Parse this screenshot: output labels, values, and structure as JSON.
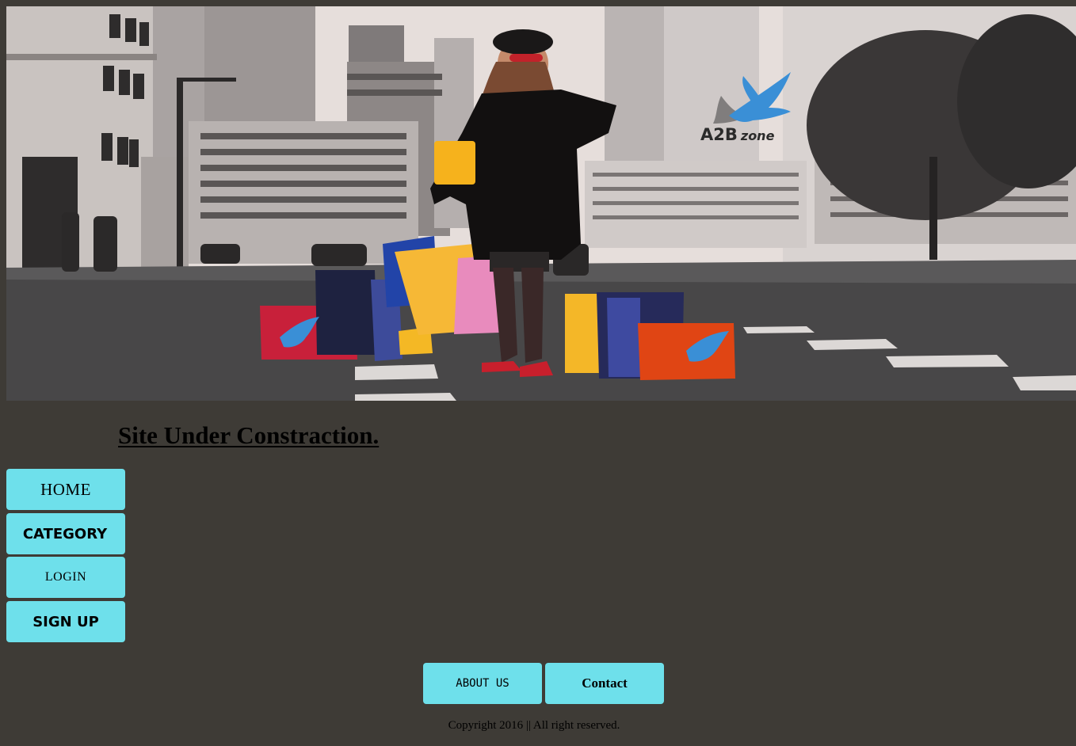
{
  "hero": {
    "brand_main": "A2B",
    "brand_sub": "zone"
  },
  "heading": "Site Under Constraction.",
  "sidebar": {
    "items": [
      {
        "label": "HOME"
      },
      {
        "label": "CATEGORY"
      },
      {
        "label": "LOGIN"
      },
      {
        "label": "SIGN UP"
      }
    ]
  },
  "footer": {
    "buttons": [
      {
        "label": "ABOUT US"
      },
      {
        "label": "Contact"
      }
    ],
    "copyright": "Copyright 2016 || All right reserved."
  },
  "colors": {
    "page_background": "#3e3b36",
    "button_background": "#6ee0eb",
    "logo_bird": "#3a8fd6"
  }
}
